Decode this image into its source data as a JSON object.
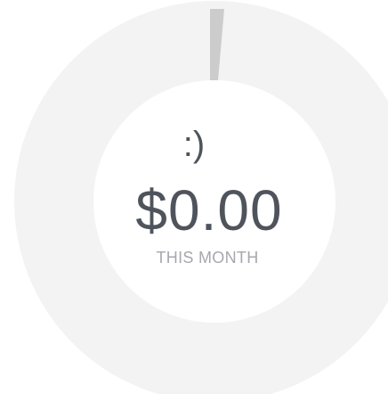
{
  "gauge": {
    "progress_fraction": 0.0,
    "track_color": "#f3f3f3",
    "marker_color": "#cccccc",
    "center_color": "#ffffff"
  },
  "summary": {
    "emoticon": ":)",
    "amount": "$0.00",
    "period_label": "THIS MONTH"
  },
  "colors": {
    "text_primary": "#4f545c",
    "text_secondary": "#a6a8ad"
  }
}
